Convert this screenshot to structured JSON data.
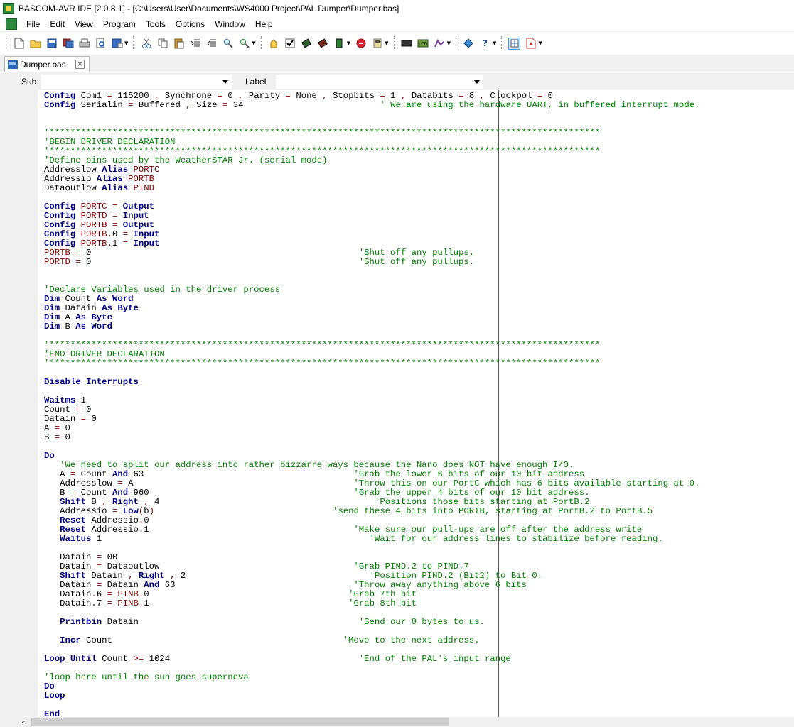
{
  "window": {
    "title": "BASCOM-AVR IDE [2.0.8.1] - [C:\\Users\\User\\Documents\\WS4000 Project\\PAL Dumper\\Dumper.bas]"
  },
  "menu": [
    "File",
    "Edit",
    "View",
    "Program",
    "Tools",
    "Options",
    "Window",
    "Help"
  ],
  "tab": {
    "label": "Dumper.bas",
    "close": "×"
  },
  "subbar": {
    "sub_label": "Sub",
    "label_label": "Label",
    "sub_value": "",
    "label_value": ""
  },
  "code_lines": [
    [
      [
        "kw",
        "Config"
      ],
      [
        "id",
        " Com1 "
      ],
      [
        "op",
        "="
      ],
      [
        "id",
        " 115200 "
      ],
      [
        "op",
        ","
      ],
      [
        "id",
        " Synchrone "
      ],
      [
        "op",
        "="
      ],
      [
        "id",
        " 0 "
      ],
      [
        "op",
        ","
      ],
      [
        "id",
        " Parity "
      ],
      [
        "op",
        "="
      ],
      [
        "id",
        " None "
      ],
      [
        "op",
        ","
      ],
      [
        "id",
        " Stopbits "
      ],
      [
        "op",
        "="
      ],
      [
        "id",
        " 1 "
      ],
      [
        "op",
        ","
      ],
      [
        "id",
        " Databits "
      ],
      [
        "op",
        "="
      ],
      [
        "id",
        " 8 "
      ],
      [
        "op",
        ","
      ],
      [
        "id",
        " Clockpol "
      ],
      [
        "op",
        "="
      ],
      [
        "id",
        " 0"
      ]
    ],
    [
      [
        "kw",
        "Config"
      ],
      [
        "id",
        " Serialin "
      ],
      [
        "op",
        "="
      ],
      [
        "id",
        " Buffered "
      ],
      [
        "op",
        ","
      ],
      [
        "id",
        " Size "
      ],
      [
        "op",
        "="
      ],
      [
        "id",
        " 34                          "
      ],
      [
        "cm",
        "' We are using the hardware UART, in buffered interrupt mode."
      ]
    ],
    [],
    [],
    [
      [
        "cm",
        "'*********************************************************************************************************"
      ]
    ],
    [
      [
        "cm",
        "'BEGIN DRIVER DECLARATION"
      ]
    ],
    [
      [
        "cm",
        "'*********************************************************************************************************"
      ]
    ],
    [
      [
        "cm",
        "'Define pins used by the WeatherSTAR Jr. (serial mode)"
      ]
    ],
    [
      [
        "id",
        "Addresslow "
      ],
      [
        "kw",
        "Alias"
      ],
      [
        "reg",
        " PORTC"
      ]
    ],
    [
      [
        "id",
        "Addressio "
      ],
      [
        "kw",
        "Alias"
      ],
      [
        "reg",
        " PORTB"
      ]
    ],
    [
      [
        "id",
        "Dataoutlow "
      ],
      [
        "kw",
        "Alias"
      ],
      [
        "reg",
        " PIND"
      ]
    ],
    [],
    [
      [
        "kw",
        "Config"
      ],
      [
        "reg",
        " PORTC "
      ],
      [
        "op",
        "="
      ],
      [
        "kw",
        " Output"
      ]
    ],
    [
      [
        "kw",
        "Config"
      ],
      [
        "reg",
        " PORTD "
      ],
      [
        "op",
        "="
      ],
      [
        "kw",
        " Input"
      ]
    ],
    [
      [
        "kw",
        "Config"
      ],
      [
        "reg",
        " PORTB "
      ],
      [
        "op",
        "="
      ],
      [
        "kw",
        " Output"
      ]
    ],
    [
      [
        "kw",
        "Config"
      ],
      [
        "reg",
        " PORTB"
      ],
      [
        "op",
        "."
      ],
      [
        "id",
        "0 "
      ],
      [
        "op",
        "="
      ],
      [
        "kw",
        " Input"
      ]
    ],
    [
      [
        "kw",
        "Config"
      ],
      [
        "reg",
        " PORTB"
      ],
      [
        "op",
        "."
      ],
      [
        "id",
        "1 "
      ],
      [
        "op",
        "="
      ],
      [
        "kw",
        " Input"
      ]
    ],
    [
      [
        "reg",
        "PORTB "
      ],
      [
        "op",
        "="
      ],
      [
        "id",
        " 0                                                   "
      ],
      [
        "cm",
        "'Shut off any pullups."
      ]
    ],
    [
      [
        "reg",
        "PORTD "
      ],
      [
        "op",
        "="
      ],
      [
        "id",
        " 0                                                   "
      ],
      [
        "cm",
        "'Shut off any pullups."
      ]
    ],
    [],
    [],
    [
      [
        "cm",
        "'Declare Variables used in the driver process"
      ]
    ],
    [
      [
        "kw",
        "Dim"
      ],
      [
        "id",
        " Count "
      ],
      [
        "kw",
        "As"
      ],
      [
        "kw",
        " Word"
      ]
    ],
    [
      [
        "kw",
        "Dim"
      ],
      [
        "id",
        " Datain "
      ],
      [
        "kw",
        "As"
      ],
      [
        "kw",
        " Byte"
      ]
    ],
    [
      [
        "kw",
        "Dim"
      ],
      [
        "id",
        " A "
      ],
      [
        "kw",
        "As"
      ],
      [
        "kw",
        " Byte"
      ]
    ],
    [
      [
        "kw",
        "Dim"
      ],
      [
        "id",
        " B "
      ],
      [
        "kw",
        "As"
      ],
      [
        "kw",
        " Word"
      ]
    ],
    [],
    [
      [
        "cm",
        "'*********************************************************************************************************"
      ]
    ],
    [
      [
        "cm",
        "'END DRIVER DECLARATION"
      ]
    ],
    [
      [
        "cm",
        "'*********************************************************************************************************"
      ]
    ],
    [],
    [
      [
        "kw",
        "Disable"
      ],
      [
        "kw",
        " Interrupts"
      ]
    ],
    [],
    [
      [
        "kw",
        "Waitms"
      ],
      [
        "id",
        " 1"
      ]
    ],
    [
      [
        "id",
        "Count "
      ],
      [
        "op",
        "="
      ],
      [
        "id",
        " 0"
      ]
    ],
    [
      [
        "id",
        "Datain "
      ],
      [
        "op",
        "="
      ],
      [
        "id",
        " 0"
      ]
    ],
    [
      [
        "id",
        "A "
      ],
      [
        "op",
        "="
      ],
      [
        "id",
        " 0"
      ]
    ],
    [
      [
        "id",
        "B "
      ],
      [
        "op",
        "="
      ],
      [
        "id",
        " 0"
      ]
    ],
    [],
    [
      [
        "kw",
        "Do"
      ]
    ],
    [
      [
        "cm",
        "   'We need to split our address into rather bizzarre ways because the Nano does NOT have enough I/O."
      ]
    ],
    [
      [
        "id",
        "   A "
      ],
      [
        "op",
        "="
      ],
      [
        "id",
        " Count "
      ],
      [
        "kw",
        "And"
      ],
      [
        "id",
        " 63                                        "
      ],
      [
        "cm",
        "'Grab the lower 6 bits of our 10 bit address"
      ]
    ],
    [
      [
        "id",
        "   Addresslow "
      ],
      [
        "op",
        "="
      ],
      [
        "id",
        " A                                          "
      ],
      [
        "cm",
        "'Throw this on our PortC which has 6 bits available starting at 0."
      ]
    ],
    [
      [
        "id",
        "   B "
      ],
      [
        "op",
        "="
      ],
      [
        "id",
        " Count "
      ],
      [
        "kw",
        "And"
      ],
      [
        "id",
        " 960                                       "
      ],
      [
        "cm",
        "'Grab the upper 4 bits of our 10 bit address."
      ]
    ],
    [
      [
        "kw",
        "   Shift"
      ],
      [
        "id",
        " B "
      ],
      [
        "op",
        ","
      ],
      [
        "kw",
        " Right"
      ],
      [
        "op",
        " ,"
      ],
      [
        "id",
        " 4                                         "
      ],
      [
        "cm",
        "'Positions those bits starting at PortB.2"
      ]
    ],
    [
      [
        "id",
        "   Addressio "
      ],
      [
        "op",
        "="
      ],
      [
        "kw",
        " Low"
      ],
      [
        "op",
        "("
      ],
      [
        "id",
        "b"
      ],
      [
        "op",
        ")"
      ],
      [
        "id",
        "                                  "
      ],
      [
        "cm",
        "'send these 4 bits into PORTB, starting at PortB.2 to PortB.5"
      ]
    ],
    [
      [
        "kw",
        "   Reset"
      ],
      [
        "id",
        " Addressio"
      ],
      [
        "op",
        "."
      ],
      [
        "id",
        "0"
      ]
    ],
    [
      [
        "kw",
        "   Reset"
      ],
      [
        "id",
        " Addressio"
      ],
      [
        "op",
        "."
      ],
      [
        "id",
        "1                                       "
      ],
      [
        "cm",
        "'Make sure our pull-ups are off after the address write"
      ]
    ],
    [
      [
        "kw",
        "   Waitus"
      ],
      [
        "id",
        " 1                                                   "
      ],
      [
        "cm",
        "'Wait for our address lines to stabilize before reading."
      ]
    ],
    [],
    [
      [
        "id",
        "   Datain "
      ],
      [
        "op",
        "="
      ],
      [
        "id",
        " 00"
      ]
    ],
    [
      [
        "id",
        "   Datain "
      ],
      [
        "op",
        "="
      ],
      [
        "id",
        " Dataoutlow                                     "
      ],
      [
        "cm",
        "'Grab PIND.2 to PIND.7"
      ]
    ],
    [
      [
        "kw",
        "   Shift"
      ],
      [
        "id",
        " Datain "
      ],
      [
        "op",
        ","
      ],
      [
        "kw",
        " Right"
      ],
      [
        "op",
        " ,"
      ],
      [
        "id",
        " 2                                   "
      ],
      [
        "cm",
        "'Position PIND.2 (Bit2) to Bit 0."
      ]
    ],
    [
      [
        "id",
        "   Datain "
      ],
      [
        "op",
        "="
      ],
      [
        "id",
        " Datain "
      ],
      [
        "kw",
        "And"
      ],
      [
        "id",
        " 63                                  "
      ],
      [
        "cm",
        "'Throw away anything above 6 bits"
      ]
    ],
    [
      [
        "id",
        "   Datain"
      ],
      [
        "op",
        "."
      ],
      [
        "id",
        "6 "
      ],
      [
        "op",
        "="
      ],
      [
        "reg",
        " PINB"
      ],
      [
        "op",
        "."
      ],
      [
        "id",
        "0                                      "
      ],
      [
        "cm",
        "'Grab 7th bit"
      ]
    ],
    [
      [
        "id",
        "   Datain"
      ],
      [
        "op",
        "."
      ],
      [
        "id",
        "7 "
      ],
      [
        "op",
        "="
      ],
      [
        "reg",
        " PINB"
      ],
      [
        "op",
        "."
      ],
      [
        "id",
        "1                                      "
      ],
      [
        "cm",
        "'Grab 8th bit"
      ]
    ],
    [],
    [
      [
        "kw",
        "   Printbin"
      ],
      [
        "id",
        " Datain                                          "
      ],
      [
        "cm",
        "'Send our 8 bytes to us."
      ]
    ],
    [],
    [
      [
        "kw",
        "   Incr"
      ],
      [
        "id",
        " Count                                            "
      ],
      [
        "cm",
        "'Move to the next address."
      ]
    ],
    [],
    [
      [
        "kw",
        "Loop"
      ],
      [
        "kw",
        " Until"
      ],
      [
        "id",
        " Count "
      ],
      [
        "op",
        ">="
      ],
      [
        "id",
        " 1024                                    "
      ],
      [
        "cm",
        "'End of the PAL's input range"
      ]
    ],
    [],
    [
      [
        "cm",
        "'loop here until the sun goes supernova"
      ]
    ],
    [
      [
        "kw",
        "Do"
      ]
    ],
    [
      [
        "kw",
        "Loop"
      ]
    ],
    [],
    [
      [
        "kw",
        "End"
      ]
    ]
  ]
}
